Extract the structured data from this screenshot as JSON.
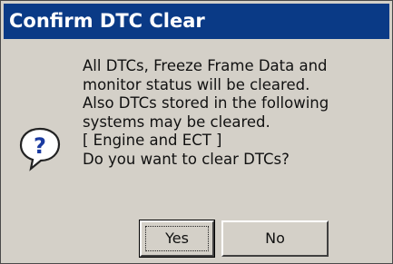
{
  "dialog": {
    "title": "Confirm DTC Clear",
    "icon": "question-icon",
    "message_lines": [
      "All DTCs, Freeze Frame Data and",
      "monitor status will be cleared.",
      "Also DTCs stored in the following",
      "systems may be cleared.",
      "[ Engine and ECT ]",
      "Do you want to clear DTCs?"
    ],
    "buttons": {
      "yes_label": "Yes",
      "no_label": "No"
    }
  },
  "colors": {
    "titlebar": "#0a3a86",
    "title_text": "#ffffff",
    "body_bg": "#d4d0c8"
  }
}
